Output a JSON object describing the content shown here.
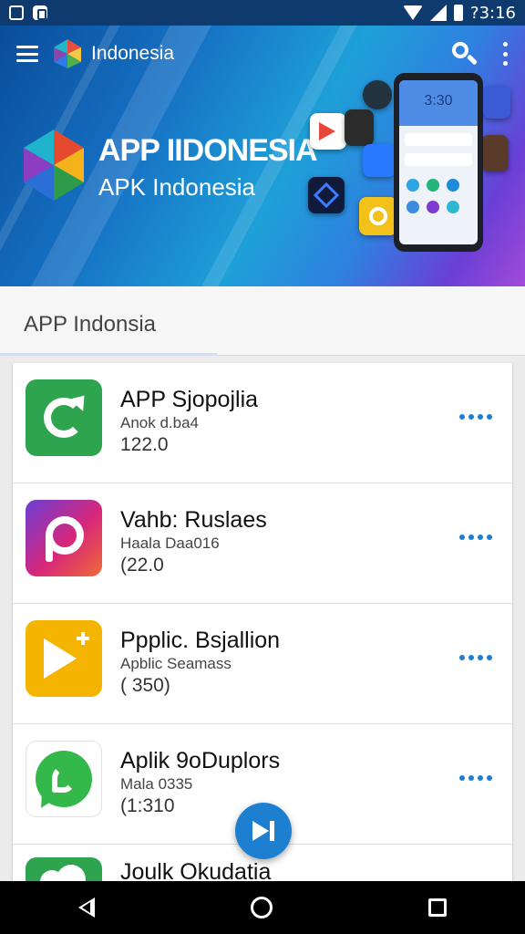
{
  "status_bar": {
    "time": "?3:16"
  },
  "header": {
    "title": "Indonesia"
  },
  "banner": {
    "title": "APP IIDONESIA",
    "subtitle": "APK Indonesia",
    "phone_clock": "3:30"
  },
  "section": {
    "title": "APP Indonsia"
  },
  "apps": [
    {
      "name": "APP Sjopojlia",
      "developer": "Anok d.ba4",
      "version": "122.0",
      "icon": "refresh-icon",
      "color": "#2ea44f"
    },
    {
      "name": "Vahb: Ruslaes",
      "developer": "Haala Daa016",
      "version": "(22.0",
      "icon": "camera-p-icon",
      "color": "#d7267b"
    },
    {
      "name": "Ppplic. Bsjallion",
      "developer": "Apblic Seamass",
      "version": "( 350)",
      "icon": "play-plus-icon",
      "color": "#f5b400"
    },
    {
      "name": "Aplik 9oDuplors",
      "developer": "Mala 0335",
      "version": "(1:310",
      "icon": "whatsapp-icon",
      "color": "#34b84a"
    },
    {
      "name": "Joulk Okudatia",
      "developer": "",
      "version": "",
      "icon": "cloud-icon",
      "color": "#2ea44f"
    }
  ],
  "colors": {
    "accent": "#1c7fd0",
    "status_bar": "#0f3a6e"
  }
}
